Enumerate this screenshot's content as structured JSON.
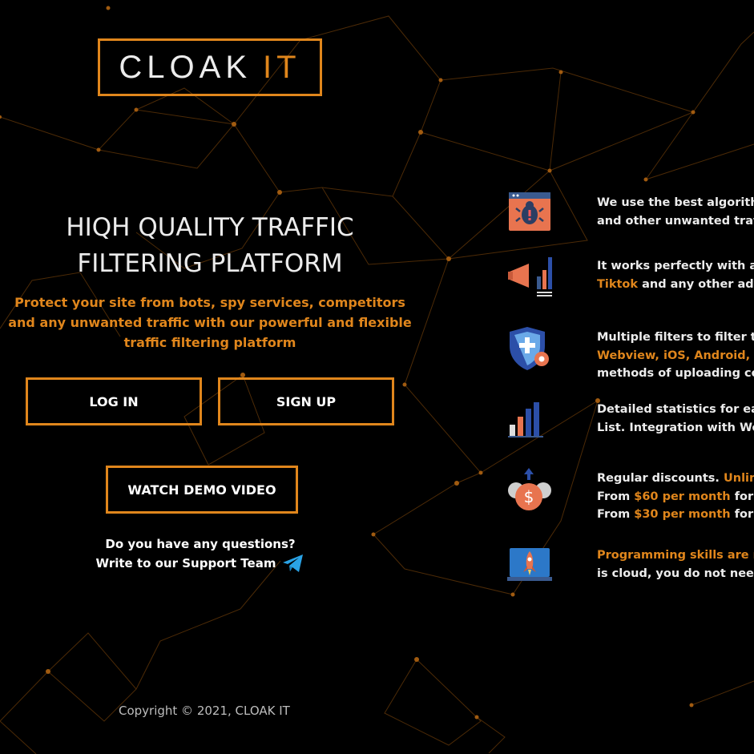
{
  "brand": {
    "name_main": "CLOAK",
    "name_accent": "IT"
  },
  "hero": {
    "title_line1": "HIQH QUALITY TRAFFIC",
    "title_line2": "FILTERING PLATFORM",
    "subtitle": "Protect your site from bots, spy services, competitors and any unwanted traffic with our powerful and flexible traffic filtering platform"
  },
  "buttons": {
    "login": "LOG IN",
    "signup": "SIGN UP",
    "demo": "WATCH DEMO VIDEO"
  },
  "support": {
    "question": "Do you have any questions?",
    "link": "Write to our Support Team"
  },
  "footer": {
    "copyright": "Copyright © 2021, CLOAK IT"
  },
  "features": [
    {
      "icon": "bug-alert-browser-icon",
      "line1": "We use the best algorithms",
      "line2": "and other unwanted traffic"
    },
    {
      "icon": "megaphone-chart-icon",
      "line1": "It works perfectly with any",
      "line2_accent": "Tiktok",
      "line2": " and any other adver"
    },
    {
      "icon": "shield-gear-icon",
      "line1": "Multiple filters to filter traf",
      "line2_accent": "Webview, iOS, Android, Wo",
      "line3": "methods of uploading conte"
    },
    {
      "icon": "bar-chart-icon",
      "line1": "Detailed statistics for each",
      "line2": "List. Integration with Websi"
    },
    {
      "icon": "dollar-coins-icon",
      "line1": "Regular discounts. ",
      "line1_accent": "Unlimite",
      "line2_pre": "From ",
      "line2_accent": "$60 per month",
      "line2": " for mo",
      "line3_pre": "From ",
      "line3_accent": "$30 per month",
      "line3": " for an"
    },
    {
      "icon": "rocket-laptop-icon",
      "line1_accent": "Programming skills are not",
      "line2": "is cloud, you do not need to"
    }
  ],
  "colors": {
    "accent": "#e0861c",
    "background": "#000000",
    "text": "#ececec"
  }
}
